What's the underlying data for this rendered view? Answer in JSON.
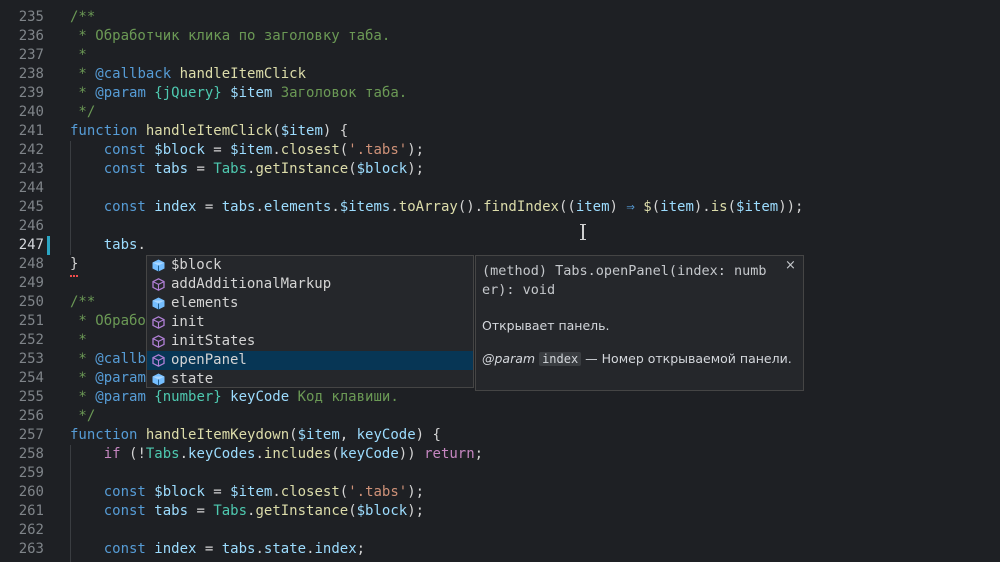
{
  "editor": {
    "lines": [
      {
        "n": "235",
        "tokens": [
          [
            "/**",
            "t-c"
          ]
        ]
      },
      {
        "n": "236",
        "tokens": [
          [
            " * Обработчик клика по заголовку таба.",
            "t-c"
          ]
        ]
      },
      {
        "n": "237",
        "tokens": [
          [
            " *",
            "t-c"
          ]
        ]
      },
      {
        "n": "238",
        "tokens": [
          [
            " * ",
            "t-c"
          ],
          [
            "@callback",
            "t-ct"
          ],
          [
            " handleItemClick",
            "t-fn"
          ]
        ]
      },
      {
        "n": "239",
        "tokens": [
          [
            " * ",
            "t-c"
          ],
          [
            "@param",
            "t-ct"
          ],
          [
            " {jQuery}",
            "t-cty"
          ],
          [
            " $item",
            "t-cv"
          ],
          [
            " Заголовок таба.",
            "t-c"
          ]
        ]
      },
      {
        "n": "240",
        "tokens": [
          [
            " */",
            "t-c"
          ]
        ]
      },
      {
        "n": "241",
        "tokens": [
          [
            "function",
            "t-k"
          ],
          [
            " ",
            "t-p"
          ],
          [
            "handleItemClick",
            "t-fn"
          ],
          [
            "(",
            "t-p"
          ],
          [
            "$item",
            "t-v"
          ],
          [
            ") {",
            "t-p"
          ]
        ]
      },
      {
        "n": "242",
        "tokens": [
          [
            "    const ",
            "t-k"
          ],
          [
            "$block",
            "t-v"
          ],
          [
            " = ",
            "t-p"
          ],
          [
            "$item",
            "t-v"
          ],
          [
            ".",
            "t-p"
          ],
          [
            "closest",
            "t-fn"
          ],
          [
            "(",
            "t-p"
          ],
          [
            "'.tabs'",
            "t-s"
          ],
          [
            ");",
            "t-p"
          ]
        ]
      },
      {
        "n": "243",
        "tokens": [
          [
            "    const ",
            "t-k"
          ],
          [
            "tabs",
            "t-v"
          ],
          [
            " = ",
            "t-p"
          ],
          [
            "Tabs",
            "t-cls"
          ],
          [
            ".",
            "t-p"
          ],
          [
            "getInstance",
            "t-fn"
          ],
          [
            "(",
            "t-p"
          ],
          [
            "$block",
            "t-v"
          ],
          [
            ");",
            "t-p"
          ]
        ]
      },
      {
        "n": "244",
        "tokens": []
      },
      {
        "n": "245",
        "tokens": [
          [
            "    const ",
            "t-k"
          ],
          [
            "index",
            "t-v"
          ],
          [
            " = ",
            "t-p"
          ],
          [
            "tabs",
            "t-v"
          ],
          [
            ".",
            "t-p"
          ],
          [
            "elements",
            "t-v"
          ],
          [
            ".",
            "t-p"
          ],
          [
            "$items",
            "t-v"
          ],
          [
            ".",
            "t-p"
          ],
          [
            "toArray",
            "t-fn"
          ],
          [
            "().",
            "t-p"
          ],
          [
            "findIndex",
            "t-fn"
          ],
          [
            "((",
            "t-p"
          ],
          [
            "item",
            "t-v"
          ],
          [
            ") ",
            "t-p"
          ],
          [
            "⇒",
            "t-k"
          ],
          [
            " ",
            "t-p"
          ],
          [
            "$",
            "t-fn"
          ],
          [
            "(",
            "t-p"
          ],
          [
            "item",
            "t-v"
          ],
          [
            ").",
            "t-p"
          ],
          [
            "is",
            "t-fn"
          ],
          [
            "(",
            "t-p"
          ],
          [
            "$item",
            "t-v"
          ],
          [
            "));",
            "t-p"
          ]
        ]
      },
      {
        "n": "246",
        "tokens": []
      },
      {
        "n": "247",
        "tokens": [
          [
            "    ",
            "t-p"
          ],
          [
            "tabs",
            "t-v"
          ],
          [
            ".",
            "t-p"
          ]
        ]
      },
      {
        "n": "248",
        "tokens": [
          [
            "}",
            "t-p"
          ]
        ]
      },
      {
        "n": "249",
        "tokens": []
      },
      {
        "n": "250",
        "tokens": [
          [
            "/**",
            "t-c"
          ]
        ]
      },
      {
        "n": "251",
        "tokens": [
          [
            " * Обрабо",
            "t-c"
          ]
        ]
      },
      {
        "n": "252",
        "tokens": [
          [
            " *",
            "t-c"
          ]
        ]
      },
      {
        "n": "253",
        "tokens": [
          [
            " * ",
            "t-c"
          ],
          [
            "@callb",
            "t-ct"
          ]
        ]
      },
      {
        "n": "254",
        "tokens": [
          [
            " * ",
            "t-c"
          ],
          [
            "@param",
            "t-ct"
          ]
        ]
      },
      {
        "n": "255",
        "tokens": [
          [
            " * ",
            "t-c"
          ],
          [
            "@param",
            "t-ct"
          ],
          [
            " {number}",
            "t-cty"
          ],
          [
            " keyCode",
            "t-cv"
          ],
          [
            " Код клавиши.",
            "t-c"
          ]
        ]
      },
      {
        "n": "256",
        "tokens": [
          [
            " */",
            "t-c"
          ]
        ]
      },
      {
        "n": "257",
        "tokens": [
          [
            "function",
            "t-k"
          ],
          [
            " ",
            "t-p"
          ],
          [
            "handleItemKeydown",
            "t-fn"
          ],
          [
            "(",
            "t-p"
          ],
          [
            "$item",
            "t-v"
          ],
          [
            ", ",
            "t-p"
          ],
          [
            "keyCode",
            "t-v"
          ],
          [
            ") {",
            "t-p"
          ]
        ]
      },
      {
        "n": "258",
        "tokens": [
          [
            "    if ",
            "t-kc"
          ],
          [
            "(!",
            "t-p"
          ],
          [
            "Tabs",
            "t-cls"
          ],
          [
            ".",
            "t-p"
          ],
          [
            "keyCodes",
            "t-v"
          ],
          [
            ".",
            "t-p"
          ],
          [
            "includes",
            "t-fn"
          ],
          [
            "(",
            "t-p"
          ],
          [
            "keyCode",
            "t-v"
          ],
          [
            ")) ",
            "t-p"
          ],
          [
            "return",
            "t-kc"
          ],
          [
            ";",
            "t-p"
          ]
        ]
      },
      {
        "n": "259",
        "tokens": []
      },
      {
        "n": "260",
        "tokens": [
          [
            "    const ",
            "t-k"
          ],
          [
            "$block",
            "t-v"
          ],
          [
            " = ",
            "t-p"
          ],
          [
            "$item",
            "t-v"
          ],
          [
            ".",
            "t-p"
          ],
          [
            "closest",
            "t-fn"
          ],
          [
            "(",
            "t-p"
          ],
          [
            "'.tabs'",
            "t-s"
          ],
          [
            ");",
            "t-p"
          ]
        ]
      },
      {
        "n": "261",
        "tokens": [
          [
            "    const ",
            "t-k"
          ],
          [
            "tabs",
            "t-v"
          ],
          [
            " = ",
            "t-p"
          ],
          [
            "Tabs",
            "t-cls"
          ],
          [
            ".",
            "t-p"
          ],
          [
            "getInstance",
            "t-fn"
          ],
          [
            "(",
            "t-p"
          ],
          [
            "$block",
            "t-v"
          ],
          [
            ");",
            "t-p"
          ]
        ]
      },
      {
        "n": "262",
        "tokens": []
      },
      {
        "n": "263",
        "tokens": [
          [
            "    const ",
            "t-k"
          ],
          [
            "index",
            "t-v"
          ],
          [
            " = ",
            "t-p"
          ],
          [
            "tabs",
            "t-v"
          ],
          [
            ".",
            "t-p"
          ],
          [
            "state",
            "t-v"
          ],
          [
            ".",
            "t-p"
          ],
          [
            "index",
            "t-v"
          ],
          [
            ";",
            "t-p"
          ]
        ]
      }
    ],
    "active_line": "247"
  },
  "suggest": {
    "items": [
      {
        "label": "$block",
        "icon": "variable-icon"
      },
      {
        "label": "addAdditionalMarkup",
        "icon": "method-icon"
      },
      {
        "label": "elements",
        "icon": "variable-icon"
      },
      {
        "label": "init",
        "icon": "method-icon"
      },
      {
        "label": "initStates",
        "icon": "method-icon"
      },
      {
        "label": "openPanel",
        "icon": "method-icon"
      },
      {
        "label": "state",
        "icon": "variable-icon"
      }
    ],
    "selected_index": 5
  },
  "details": {
    "signature": "(method) Tabs.openPanel(index: numb\ner): void",
    "close_glyph": "×",
    "description": "Открывает панель.",
    "param_tag": "@param",
    "param_name": "index",
    "param_text": "— Номер открываемой панели."
  },
  "colors": {
    "background": "#1e2024",
    "selection": "#073655",
    "variable_icon": "#75beff",
    "method_icon": "#b180d7",
    "modified_marker": "#2aa6c4"
  }
}
